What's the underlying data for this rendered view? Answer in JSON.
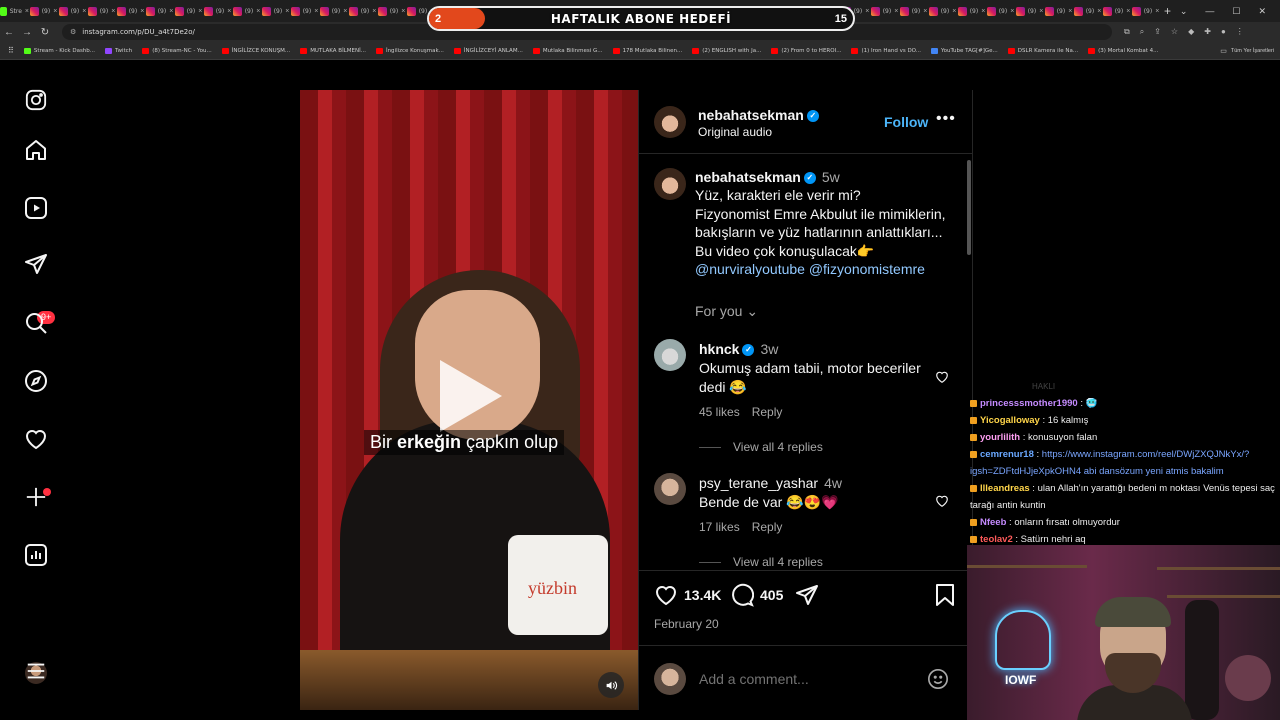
{
  "browser": {
    "tabs": [
      {
        "label": "Stre",
        "kind": "kick"
      },
      {
        "label": "(9)",
        "kind": "ig"
      },
      {
        "label": "(9)",
        "kind": "ig"
      },
      {
        "label": "(9)",
        "kind": "ig"
      },
      {
        "label": "(9)",
        "kind": "ig"
      },
      {
        "label": "(9)",
        "kind": "ig"
      },
      {
        "label": "(9)",
        "kind": "ig"
      },
      {
        "label": "(9)",
        "kind": "ig"
      },
      {
        "label": "(9)",
        "kind": "ig"
      },
      {
        "label": "(9)",
        "kind": "ig"
      },
      {
        "label": "(9)",
        "kind": "ig"
      },
      {
        "label": "(9)",
        "kind": "ig"
      },
      {
        "label": "(9)",
        "kind": "ig"
      },
      {
        "label": "(9)",
        "kind": "ig"
      },
      {
        "label": "(9)",
        "kind": "ig"
      },
      {
        "label": "(9)",
        "kind": "ig"
      },
      {
        "label": "(9)",
        "kind": "ig"
      },
      {
        "label": "(9)",
        "kind": "ig"
      },
      {
        "label": "(9)",
        "kind": "ig"
      },
      {
        "label": "(9)",
        "kind": "ig"
      },
      {
        "label": "(9)",
        "kind": "ig"
      },
      {
        "label": "(9)",
        "kind": "ig"
      },
      {
        "label": "(9)",
        "kind": "ig"
      },
      {
        "label": "(9)",
        "kind": "ig"
      },
      {
        "label": "(9)",
        "kind": "ig"
      },
      {
        "label": "(9)",
        "kind": "ig"
      },
      {
        "label": "(9)",
        "kind": "ig"
      },
      {
        "label": "(9)",
        "kind": "ig"
      },
      {
        "label": "(9)",
        "kind": "ig"
      },
      {
        "label": "(9)",
        "kind": "ig"
      },
      {
        "label": "(9)",
        "kind": "ig"
      },
      {
        "label": "(9)",
        "kind": "ig"
      },
      {
        "label": "(9)",
        "kind": "ig"
      },
      {
        "label": "(9)",
        "kind": "ig"
      },
      {
        "label": "(9)",
        "kind": "ig"
      },
      {
        "label": "(9)",
        "kind": "ig"
      },
      {
        "label": "(9)",
        "kind": "ig"
      },
      {
        "label": "(9)",
        "kind": "ig"
      },
      {
        "label": "(9)",
        "kind": "ig"
      },
      {
        "label": "(9)",
        "kind": "ig"
      }
    ],
    "url": "instagram.com/p/DU_a4t7De2o/",
    "bookmarks": [
      {
        "label": "Stream - Kick Dashb...",
        "kind": "k"
      },
      {
        "label": "Twitch",
        "kind": "tw"
      },
      {
        "label": "(8) Stream-NC - You...",
        "kind": "yt"
      },
      {
        "label": "İNGİLİZCE KONUŞM...",
        "kind": "yt"
      },
      {
        "label": "MUTLAKA BİLMENİ...",
        "kind": "yt"
      },
      {
        "label": "İngilizce Konuşmak...",
        "kind": "yt"
      },
      {
        "label": "İNGİLİZCEYİ ANLAM...",
        "kind": "yt"
      },
      {
        "label": "Mutlaka Bilinmesi G...",
        "kind": "yt"
      },
      {
        "label": "178 Mutlaka Bilinen...",
        "kind": "yt"
      },
      {
        "label": "(2) ENGLISH with Ja...",
        "kind": "yt"
      },
      {
        "label": "(2) From 0 to HEROI...",
        "kind": "yt"
      },
      {
        "label": "(1) Iron Hand vs DO...",
        "kind": "yt"
      },
      {
        "label": "YouTube TAG[#]Ge...",
        "kind": "g"
      },
      {
        "label": "DSLR Kamera ile Na...",
        "kind": "yt"
      },
      {
        "label": "(3) Mortal Kombat 4...",
        "kind": "yt"
      }
    ],
    "bookmarks_all": "Tüm Yer İşaretleri"
  },
  "overlay": {
    "title": "HAFTALIK ABONE HEDEFİ",
    "current": "2",
    "goal": "15",
    "progress_fraction": 0.133,
    "fill_color": "#e2481c"
  },
  "ig_nav": {
    "items": [
      "instagram-logo-icon",
      "home-icon",
      "reels-icon",
      "messages-icon",
      "search-icon",
      "explore-icon",
      "notifications-icon",
      "create-icon",
      "dashboard-icon",
      "profile-icon",
      "more-menu-icon"
    ],
    "messages_badge": "9+"
  },
  "video": {
    "subtitle_plain_1": "Bir ",
    "subtitle_bold": "erkeğin",
    "subtitle_plain_2": " çapkın olup",
    "mug_text": "yüzbin"
  },
  "post": {
    "username": "nebahatsekman",
    "audio": "Original audio",
    "follow": "Follow",
    "caption_time": "5w",
    "caption_lines": [
      "Yüz, karakteri ele verir mi?",
      "Fizyonomist Emre Akbulut ile mimiklerin,",
      "bakışların ve yüz hatlarının anlattıkları...",
      "Bu video çok konuşulacak👉"
    ],
    "mentions": [
      "@nurviralyoutube",
      "@fizyonomistemre"
    ],
    "for_you": "For you",
    "comments": [
      {
        "username": "hknck",
        "time": "3w",
        "text": "Okumuş adam tabii, motor beceriler dedi 😂",
        "likes": "45 likes",
        "reply": "Reply",
        "view_all": "View all 4 replies"
      },
      {
        "username": "psy_terane_yashar",
        "time": "4w",
        "text": "Bende de var 😂😍💗",
        "likes": "17 likes",
        "reply": "Reply",
        "view_all": "View all 4 replies"
      }
    ],
    "like_count": "13.4K",
    "comment_count": "405",
    "date": "February 20",
    "add_comment_placeholder": "Add a comment..."
  },
  "stream_chat": {
    "header": "HAKLI",
    "messages": [
      {
        "user": "princesssmother1990",
        "color": "#c58bff",
        "text": "🥶"
      },
      {
        "user": "Yicogalloway",
        "color": "#ffd54a",
        "text": "16 kalmış"
      },
      {
        "user": "yourlilith",
        "color": "#ff9ff3",
        "text": "konusuyon falan"
      },
      {
        "user": "cemrenur18",
        "color": "#6aa8ff",
        "text": "https://www.instagram.com/reel/DWjZXQJNkYx/?"
      },
      {
        "user": "",
        "color": "#6aa8ff",
        "text": "igsh=ZDFtdHJjeXpkOHN4 abi dansözum yeni atmis bakalim"
      },
      {
        "user": "llleandreas",
        "color": "#ffd54a",
        "text": "ulan Allah'ın yarattığı bedeni m noktası Venüs tepesi saç"
      },
      {
        "user": "",
        "color": "#fff",
        "text": "tarağı antin kuntin"
      },
      {
        "user": "Nfeeb",
        "color": "#c58bff",
        "text": "onların fırsatı olmuyordur"
      },
      {
        "user": "teolav2",
        "color": "#ff5a5a",
        "text": "Satürn nehri aq"
      }
    ]
  },
  "webcam": {
    "neon_text": "IOWF"
  }
}
